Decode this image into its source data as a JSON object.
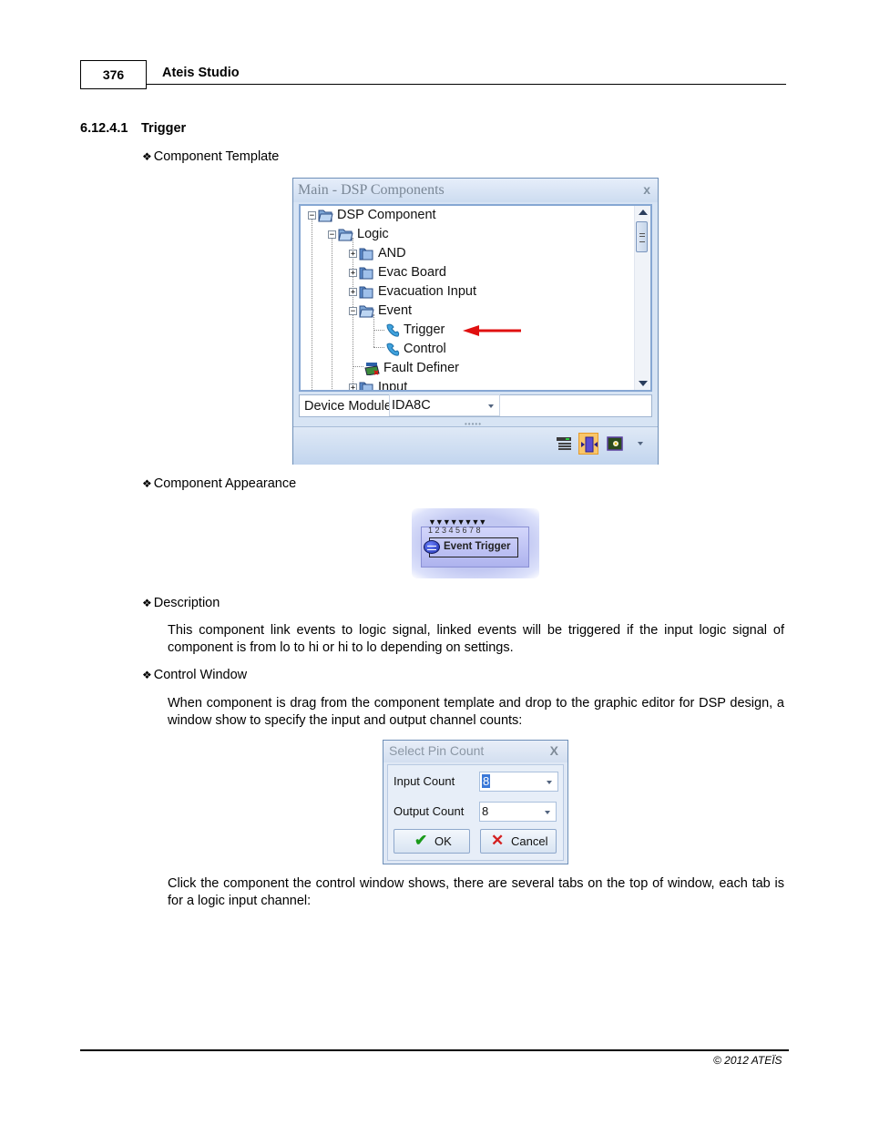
{
  "header": {
    "page_number": "376",
    "title": "Ateis Studio"
  },
  "section": {
    "number": "6.12.4.1",
    "title": "Trigger"
  },
  "bullets": {
    "component_template": "Component Template",
    "component_appearance": "Component Appearance",
    "description": "Description",
    "control_window": "Control Window"
  },
  "paragraphs": {
    "description": "This component link events to logic signal, linked events will be triggered if the input logic signal of component is from lo to hi or hi to lo depending on settings.",
    "control_window": "When component is drag from the component template and drop to the graphic editor for DSP design, a window show to specify the input and output channel counts:",
    "click_component": "Click the component the control window shows, there are several tabs on the top of window, each tab is for a logic input channel:"
  },
  "dsp_window": {
    "title": "Main - DSP Components",
    "close_glyph": "x",
    "tree": [
      {
        "label": "DSP Component",
        "expander": "−",
        "icon": "folder-open-icon"
      },
      {
        "label": "Logic",
        "expander": "−",
        "icon": "folder-open-icon"
      },
      {
        "label": "AND",
        "expander": "+",
        "icon": "folder-closed-icon"
      },
      {
        "label": "Evac Board",
        "expander": "+",
        "icon": "folder-closed-icon"
      },
      {
        "label": "Evacuation Input",
        "expander": "+",
        "icon": "folder-closed-icon"
      },
      {
        "label": "Event",
        "expander": "−",
        "icon": "folder-open-icon"
      },
      {
        "label": "Trigger",
        "expander": "",
        "icon": "phone-handset-icon",
        "highlighted": true
      },
      {
        "label": "Control",
        "expander": "",
        "icon": "phone-handset-icon"
      },
      {
        "label": "Fault Definer",
        "expander": "",
        "icon": "fault-definer-icon"
      },
      {
        "label": "Input",
        "expander": "+",
        "icon": "folder-closed-icon"
      }
    ],
    "device_module_label": "Device Module",
    "device_module_value": "IDA8C",
    "toolbar_icons": [
      "list-view-icon",
      "component-view-icon",
      "image-view-icon"
    ],
    "grip": "•••••",
    "arrow_color": "#e01010"
  },
  "component_appearance": {
    "label": "Event Trigger",
    "pins": "▼▼▼▼▼▼▼▼",
    "pin_numbers": "12345678"
  },
  "pin_dialog": {
    "title": "Select Pin Count",
    "close_glyph": "X",
    "input_count_label": "Input Count",
    "input_count_value": "8",
    "output_count_label": "Output Count",
    "output_count_value": "8",
    "ok_label": "OK",
    "cancel_label": "Cancel",
    "ok_glyph": "✔",
    "cancel_glyph": "✕"
  },
  "footer": {
    "copyright": "© 2012 ATEÏS"
  }
}
